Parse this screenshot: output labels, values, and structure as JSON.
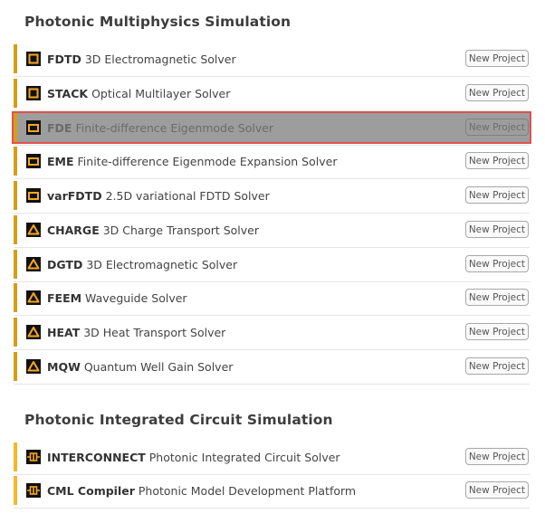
{
  "sections": [
    {
      "title": "Photonic Multiphysics Simulation",
      "items": [
        {
          "name": "FDTD",
          "desc": "3D Electromagnetic Solver",
          "button": "New Project",
          "icon": "fdtd-square-icon"
        },
        {
          "name": "STACK",
          "desc": "Optical Multilayer Solver",
          "button": "New Project",
          "icon": "stack-square-icon"
        },
        {
          "name": "FDE",
          "desc": "Finite-difference Eigenmode Solver",
          "button": "New Project",
          "icon": "fde-mode-icon"
        },
        {
          "name": "EME",
          "desc": "Finite-difference Eigenmode Expansion Solver",
          "button": "New Project",
          "icon": "eme-mode-icon"
        },
        {
          "name": "varFDTD",
          "desc": "2.5D variational FDTD Solver",
          "button": "New Project",
          "icon": "varfdtd-mode-icon"
        },
        {
          "name": "CHARGE",
          "desc": "3D Charge Transport Solver",
          "button": "New Project",
          "icon": "charge-triangle-icon"
        },
        {
          "name": "DGTD",
          "desc": "3D Electromagnetic Solver",
          "button": "New Project",
          "icon": "dgtd-triangle-icon"
        },
        {
          "name": "FEEM",
          "desc": "Waveguide Solver",
          "button": "New Project",
          "icon": "feem-triangle-icon"
        },
        {
          "name": "HEAT",
          "desc": "3D Heat Transport Solver",
          "button": "New Project",
          "icon": "heat-triangle-icon"
        },
        {
          "name": "MQW",
          "desc": "Quantum Well Gain Solver",
          "button": "New Project",
          "icon": "mqw-triangle-icon"
        }
      ]
    },
    {
      "title": "Photonic Integrated Circuit Simulation",
      "items": [
        {
          "name": "INTERCONNECT",
          "desc": "Photonic Integrated Circuit Solver",
          "button": "New Project",
          "icon": "interconnect-circuit-icon"
        },
        {
          "name": "CML Compiler",
          "desc": "Photonic Model Development Platform",
          "button": "New Project",
          "icon": "cml-circuit-icon"
        }
      ]
    }
  ],
  "colors": {
    "accent": "#d79d18",
    "icon_orange": "#f5a623",
    "selected_bg": "#9d9d9d",
    "selected_border": "#e0524f"
  },
  "selected_item": "FDE"
}
